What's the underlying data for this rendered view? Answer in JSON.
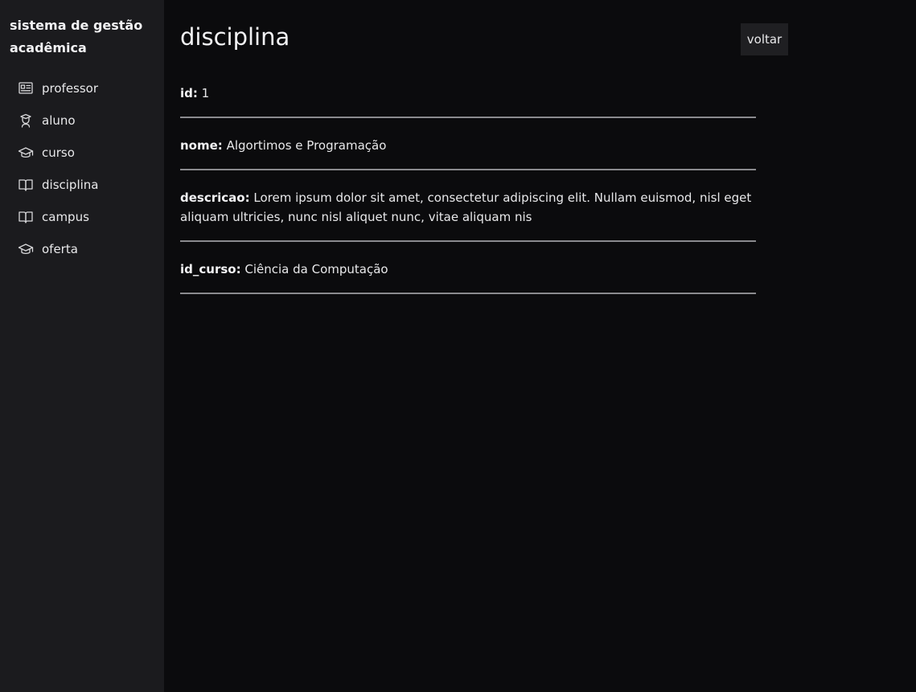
{
  "sidebar": {
    "brand": "sistema de gestão acadêmica",
    "items": [
      {
        "label": "professor",
        "icon": "id-card-icon"
      },
      {
        "label": "aluno",
        "icon": "student-icon"
      },
      {
        "label": "curso",
        "icon": "graduation-cap-icon"
      },
      {
        "label": "disciplina",
        "icon": "book-icon"
      },
      {
        "label": "campus",
        "icon": "book-icon"
      },
      {
        "label": "oferta",
        "icon": "graduation-cap-icon"
      }
    ]
  },
  "main": {
    "title": "disciplina",
    "back_label": "voltar",
    "fields": [
      {
        "label": "id:",
        "value": "1"
      },
      {
        "label": "nome:",
        "value": "Algortimos e Programação"
      },
      {
        "label": "descricao:",
        "value": "Lorem ipsum dolor sit amet, consectetur adipiscing elit. Nullam euismod, nisl eget aliquam ultricies, nunc nisl aliquet nunc, vitae aliquam nis"
      },
      {
        "label": "id_curso:",
        "value": "Ciência da Computação"
      }
    ]
  },
  "colors": {
    "background": "#0b0b0d",
    "sidebar": "#1b1b1e",
    "button": "#1f1f22",
    "divider": "#8a8a8e"
  }
}
